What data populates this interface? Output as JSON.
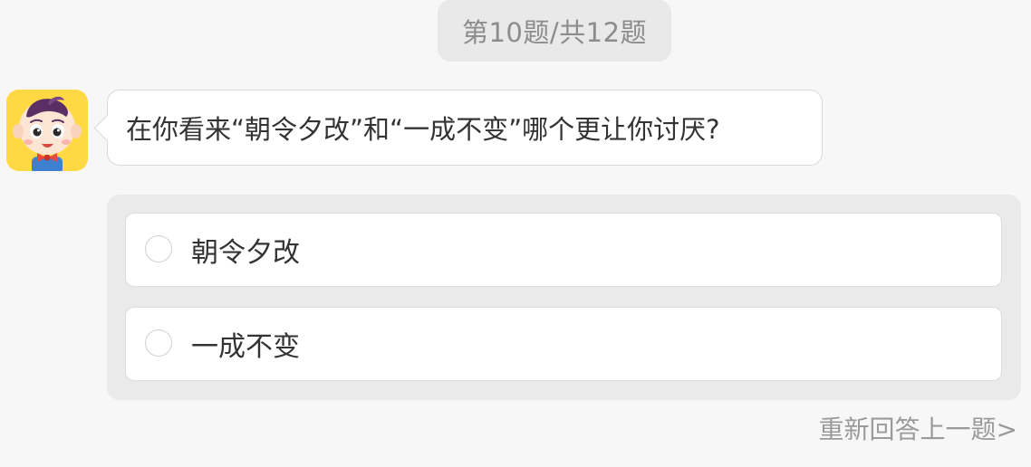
{
  "progress": {
    "label": "第10题/共12题",
    "current": 10,
    "total": 12
  },
  "avatar": {
    "icon": "cartoon-boy-mascot-icon",
    "background_color": "#ffd944"
  },
  "question": {
    "text": "在你看来“朝令夕改”和“一成不变”哪个更让你讨厌?"
  },
  "options": [
    {
      "label": "朝令夕改",
      "selected": false
    },
    {
      "label": "一成不变",
      "selected": false
    }
  ],
  "footer": {
    "redo_label": "重新回答上一题>"
  },
  "colors": {
    "page_background": "#f7f7f7",
    "panel_background": "#eaeaea",
    "text": "#333333",
    "muted_text": "#9a9a9a"
  }
}
